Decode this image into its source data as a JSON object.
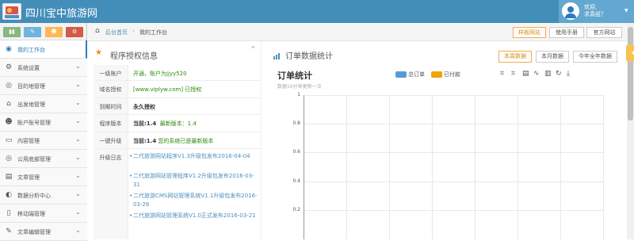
{
  "header": {
    "site_name": "四川宝中旅游网",
    "welcome_line1": "欢迎,",
    "welcome_line2": "求真组？"
  },
  "sidebar": {
    "shortcut_colors": [
      "#87b87f",
      "#6fb3e0",
      "#ffb752",
      "#d15b47"
    ],
    "items": [
      {
        "label": "我的工作台",
        "icon": "dashboard-icon",
        "active": true
      },
      {
        "label": "系统设置",
        "icon": "cogs-icon"
      },
      {
        "label": "目的地管理",
        "icon": "globe-icon"
      },
      {
        "label": "出发地管理",
        "icon": "home-icon"
      },
      {
        "label": "账户账号管理",
        "icon": "users-icon"
      },
      {
        "label": "内容管理",
        "icon": "folder-icon"
      },
      {
        "label": "公用底部管理",
        "icon": "globe-icon"
      },
      {
        "label": "文章管理",
        "icon": "file-icon"
      },
      {
        "label": "数据分析中心",
        "icon": "chart-icon"
      },
      {
        "label": "移动端管理",
        "icon": "mobile-icon"
      },
      {
        "label": "文章编辑管理",
        "icon": "edit-icon"
      }
    ]
  },
  "breadcrumb": {
    "home": "后台首页",
    "separator": "›",
    "current": "我的工作台"
  },
  "top_buttons": [
    "样板网站",
    "使用手册",
    "官方网站"
  ],
  "program_panel": {
    "title": "程序授权信息",
    "rows": [
      {
        "key": "一级账户",
        "value": "开通，账户为jjyy520"
      },
      {
        "key": "域名授权",
        "value": "[www.viplyw.com] 已授权"
      },
      {
        "key": "到期时间",
        "value": "永久授权"
      },
      {
        "key": "程序版本",
        "value_a": "当前:1.4",
        "value_b": "最新版本：1.4"
      },
      {
        "key": "一键升级",
        "value_a": "当前:1.4",
        "value_b": "您的系统已是最新版本"
      },
      {
        "key": "升级日志"
      }
    ],
    "logs": [
      "二代旅游网站程序V1.3升级包发布2016-04-04",
      "二代旅游网站管理程序V1.2升级包发布2016-03-31",
      "二代旅游CMS网站管理系统V1.1升级包发布2016-03-26",
      "二代旅游网站管理系统V1.0正式发布2016-03-21"
    ]
  },
  "order_panel": {
    "title": "订单数据统计",
    "buttons": [
      "本周数据",
      "本月数据",
      "今年全年数据"
    ]
  },
  "chart_data": {
    "type": "bar",
    "title": "订单统计",
    "subtitle": "数据10分钟更新一次",
    "legend": [
      "总订单",
      "已付款"
    ],
    "legend_colors": [
      "#5b9bd5",
      "#f0a30a"
    ],
    "ylim": [
      0,
      1
    ],
    "yticks": [
      "1",
      "0.8",
      "0.6",
      "0.4",
      "0.2"
    ],
    "grid": true
  }
}
